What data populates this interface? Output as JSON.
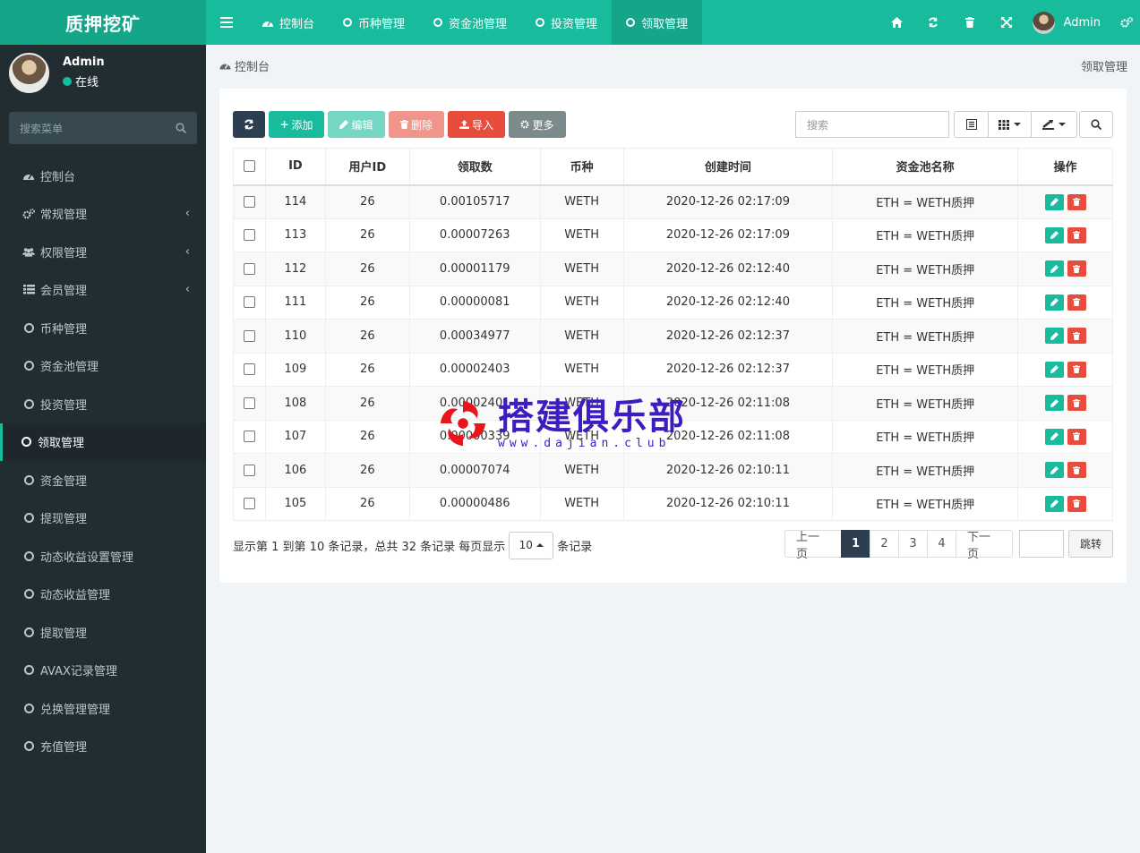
{
  "app": {
    "logo": "质押挖矿"
  },
  "topnav": {
    "tabs": [
      {
        "label": "控制台"
      },
      {
        "label": "币种管理"
      },
      {
        "label": "资金池管理"
      },
      {
        "label": "投资管理"
      },
      {
        "label": "领取管理"
      }
    ],
    "user": "Admin"
  },
  "sidebar": {
    "user_name": "Admin",
    "user_status": "在线",
    "search_placeholder": "搜索菜单",
    "items": [
      {
        "label": "控制台"
      },
      {
        "label": "常规管理"
      },
      {
        "label": "权限管理"
      },
      {
        "label": "会员管理"
      },
      {
        "label": "币种管理"
      },
      {
        "label": "资金池管理"
      },
      {
        "label": "投资管理"
      },
      {
        "label": "领取管理"
      },
      {
        "label": "资金管理"
      },
      {
        "label": "提现管理"
      },
      {
        "label": "动态收益设置管理"
      },
      {
        "label": "动态收益管理"
      },
      {
        "label": "提取管理"
      },
      {
        "label": "AVAX记录管理"
      },
      {
        "label": "兑换管理管理"
      },
      {
        "label": "充值管理"
      }
    ]
  },
  "header": {
    "breadcrumb": "控制台",
    "page_tag": "领取管理"
  },
  "toolbar": {
    "add": "添加",
    "edit": "编辑",
    "delete": "删除",
    "import": "导入",
    "more": "更多",
    "search_placeholder": "搜索"
  },
  "table": {
    "columns": [
      "ID",
      "用户ID",
      "领取数",
      "币种",
      "创建时间",
      "资金池名称",
      "操作"
    ],
    "rows": [
      {
        "id": "114",
        "uid": "26",
        "amount": "0.00105717",
        "coin": "WETH",
        "time": "2020-12-26 02:17:09",
        "pool": "ETH = WETH质押"
      },
      {
        "id": "113",
        "uid": "26",
        "amount": "0.00007263",
        "coin": "WETH",
        "time": "2020-12-26 02:17:09",
        "pool": "ETH = WETH质押"
      },
      {
        "id": "112",
        "uid": "26",
        "amount": "0.00001179",
        "coin": "WETH",
        "time": "2020-12-26 02:12:40",
        "pool": "ETH = WETH质押"
      },
      {
        "id": "111",
        "uid": "26",
        "amount": "0.00000081",
        "coin": "WETH",
        "time": "2020-12-26 02:12:40",
        "pool": "ETH = WETH质押"
      },
      {
        "id": "110",
        "uid": "26",
        "amount": "0.00034977",
        "coin": "WETH",
        "time": "2020-12-26 02:12:37",
        "pool": "ETH = WETH质押"
      },
      {
        "id": "109",
        "uid": "26",
        "amount": "0.00002403",
        "coin": "WETH",
        "time": "2020-12-26 02:12:37",
        "pool": "ETH = WETH质押"
      },
      {
        "id": "108",
        "uid": "26",
        "amount": "0.00002401",
        "coin": "WETH",
        "time": "2020-12-26 02:11:08",
        "pool": "ETH = WETH质押"
      },
      {
        "id": "107",
        "uid": "26",
        "amount": "0.00000339",
        "coin": "WETH",
        "time": "2020-12-26 02:11:08",
        "pool": "ETH = WETH质押"
      },
      {
        "id": "106",
        "uid": "26",
        "amount": "0.00007074",
        "coin": "WETH",
        "time": "2020-12-26 02:10:11",
        "pool": "ETH = WETH质押"
      },
      {
        "id": "105",
        "uid": "26",
        "amount": "0.00000486",
        "coin": "WETH",
        "time": "2020-12-26 02:10:11",
        "pool": "ETH = WETH质押"
      }
    ]
  },
  "footer": {
    "info_prefix": "显示第 1 到第 10 条记录，总共 32 条记录 每页显示",
    "page_size": "10",
    "info_suffix": "条记录",
    "prev": "上一页",
    "pages": [
      "1",
      "2",
      "3",
      "4"
    ],
    "next": "下一页",
    "jump": "跳转"
  },
  "watermark": {
    "title": "搭建俱乐部",
    "url": "www.dajian.club"
  },
  "colors": {
    "primary": "#18bc9c",
    "sidebar": "#222d32",
    "dark": "#2c3e50",
    "danger": "#e74c3c"
  }
}
